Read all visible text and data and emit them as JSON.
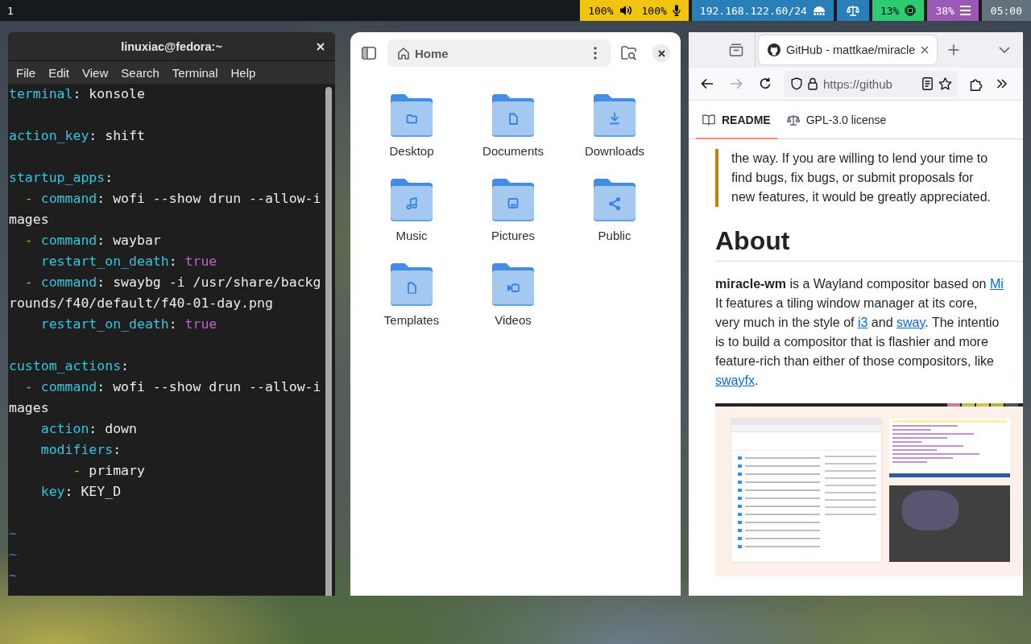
{
  "top_bar": {
    "workspaces": [
      {
        "label": "1"
      }
    ],
    "modules": [
      {
        "kind": "audio",
        "volume": "100%",
        "mic": "100%"
      },
      {
        "kind": "network",
        "text": "192.168.122.60/24"
      },
      {
        "kind": "power-profile"
      },
      {
        "kind": "cpu",
        "text": "13%"
      },
      {
        "kind": "memory",
        "text": "38%"
      },
      {
        "kind": "clock",
        "text": "05:00"
      }
    ]
  },
  "terminal": {
    "title": "linuxiac@fedora:~",
    "menu": [
      "File",
      "Edit",
      "View",
      "Search",
      "Terminal",
      "Help"
    ],
    "lines": [
      {
        "kind": "code",
        "parts": [
          {
            "kind": "key",
            "text": "terminal"
          },
          {
            "kind": "plain",
            "text": ": konsole"
          }
        ]
      },
      {
        "kind": "blank"
      },
      {
        "kind": "code",
        "parts": [
          {
            "kind": "key",
            "text": "action_key"
          },
          {
            "kind": "plain",
            "text": ": shift"
          }
        ]
      },
      {
        "kind": "blank"
      },
      {
        "kind": "code",
        "parts": [
          {
            "kind": "key",
            "text": "startup_apps"
          },
          {
            "kind": "plain",
            "text": ":"
          }
        ]
      },
      {
        "kind": "code",
        "parts": [
          {
            "kind": "dash",
            "text": "  - "
          },
          {
            "kind": "key",
            "text": "command"
          },
          {
            "kind": "plain",
            "text": ": wofi --show drun --allow-i"
          }
        ]
      },
      {
        "kind": "code",
        "parts": [
          {
            "kind": "plain",
            "text": "mages"
          }
        ]
      },
      {
        "kind": "code",
        "parts": [
          {
            "kind": "dash",
            "text": "  - "
          },
          {
            "kind": "key",
            "text": "command"
          },
          {
            "kind": "plain",
            "text": ": waybar"
          }
        ]
      },
      {
        "kind": "code",
        "parts": [
          {
            "kind": "key",
            "text": "    restart_on_death"
          },
          {
            "kind": "plain",
            "text": ": "
          },
          {
            "kind": "bool",
            "text": "true"
          }
        ]
      },
      {
        "kind": "code",
        "parts": [
          {
            "kind": "dash",
            "text": "  - "
          },
          {
            "kind": "key",
            "text": "command"
          },
          {
            "kind": "plain",
            "text": ": swaybg -i /usr/share/backg"
          }
        ]
      },
      {
        "kind": "code",
        "parts": [
          {
            "kind": "plain",
            "text": "rounds/f40/default/f40-01-day.png"
          }
        ]
      },
      {
        "kind": "code",
        "parts": [
          {
            "kind": "key",
            "text": "    restart_on_death"
          },
          {
            "kind": "plain",
            "text": ": "
          },
          {
            "kind": "bool",
            "text": "true"
          }
        ]
      },
      {
        "kind": "blank"
      },
      {
        "kind": "code",
        "parts": [
          {
            "kind": "key",
            "text": "custom_actions"
          },
          {
            "kind": "plain",
            "text": ":"
          }
        ]
      },
      {
        "kind": "code",
        "parts": [
          {
            "kind": "dash",
            "text": "  - "
          },
          {
            "kind": "key",
            "text": "command"
          },
          {
            "kind": "plain",
            "text": ": wofi --show drun --allow-i"
          }
        ]
      },
      {
        "kind": "code",
        "parts": [
          {
            "kind": "plain",
            "text": "mages"
          }
        ]
      },
      {
        "kind": "code",
        "parts": [
          {
            "kind": "key",
            "text": "    action"
          },
          {
            "kind": "plain",
            "text": ": down"
          }
        ]
      },
      {
        "kind": "code",
        "parts": [
          {
            "kind": "key",
            "text": "    modifiers"
          },
          {
            "kind": "plain",
            "text": ":"
          }
        ]
      },
      {
        "kind": "code",
        "parts": [
          {
            "kind": "dash",
            "text": "        - "
          },
          {
            "kind": "plain",
            "text": "primary"
          }
        ]
      },
      {
        "kind": "code",
        "parts": [
          {
            "kind": "key",
            "text": "    key"
          },
          {
            "kind": "plain",
            "text": ": KEY_D"
          }
        ]
      },
      {
        "kind": "blank"
      },
      {
        "kind": "code",
        "parts": [
          {
            "kind": "tilde",
            "text": "~"
          }
        ]
      },
      {
        "kind": "code",
        "parts": [
          {
            "kind": "tilde",
            "text": "~"
          }
        ]
      },
      {
        "kind": "code",
        "parts": [
          {
            "kind": "tilde",
            "text": "~"
          }
        ]
      }
    ]
  },
  "file_manager": {
    "path": "Home",
    "folders": [
      {
        "name": "Desktop",
        "kind": "folder"
      },
      {
        "name": "Documents",
        "kind": "document"
      },
      {
        "name": "Downloads",
        "kind": "download"
      },
      {
        "name": "Music",
        "kind": "music"
      },
      {
        "name": "Pictures",
        "kind": "image"
      },
      {
        "name": "Public",
        "kind": "share"
      },
      {
        "name": "Templates",
        "kind": "template"
      },
      {
        "name": "Videos",
        "kind": "video"
      }
    ]
  },
  "browser": {
    "tabs": [
      {
        "title": "GitHub - mattkae/miracle",
        "selected": true
      }
    ],
    "nav_buttons": [
      {
        "kind": "back",
        "disabled": false
      },
      {
        "kind": "forward",
        "disabled": true
      },
      {
        "kind": "reload",
        "disabled": false
      }
    ],
    "url": "https://github",
    "readme_tabs": [
      {
        "kind": "readme",
        "label": "README",
        "selected": true
      },
      {
        "kind": "license",
        "label": "GPL-3.0 license",
        "selected": false
      }
    ],
    "blockquote": [
      "the way. If you are willing to lend your time to",
      "find bugs, fix bugs, or submit proposals for",
      "new features, it would be greatly appreciated."
    ],
    "heading": "About",
    "paragraph": [
      [
        {
          "kind": "text",
          "text": "**miracle-wm** is a Wayland compositor based on "
        },
        {
          "kind": "link",
          "text": "Mi"
        }
      ],
      [
        {
          "kind": "text",
          "text": "It features a tiling window manager at its core,"
        }
      ],
      [
        {
          "kind": "text",
          "text": "very much in the style of "
        },
        {
          "kind": "link",
          "text": "i3"
        },
        {
          "kind": "text",
          "text": " and "
        },
        {
          "kind": "link",
          "text": "sway"
        },
        {
          "kind": "text",
          "text": ". The intentio"
        }
      ],
      [
        {
          "kind": "text",
          "text": "is to build a compositor that is flashier and more"
        }
      ],
      [
        {
          "kind": "text",
          "text": "feature-rich than either of those compositors, like"
        }
      ],
      [
        {
          "kind": "link",
          "text": "swayfx"
        },
        {
          "kind": "text",
          "text": "."
        }
      ]
    ]
  }
}
